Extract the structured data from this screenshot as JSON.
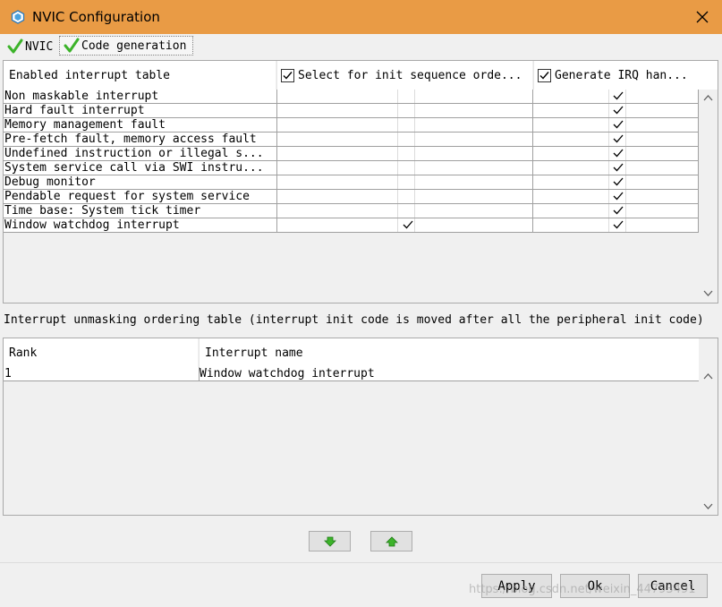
{
  "window": {
    "title": "NVIC Configuration",
    "accent": "#e99b45"
  },
  "tabs": [
    {
      "label": "NVIC",
      "icon": "check-icon"
    },
    {
      "label": "Code generation",
      "icon": "check-icon",
      "selected": true
    }
  ],
  "interrupt_table": {
    "headers": {
      "name": "Enabled interrupt table",
      "select": "Select for init sequence orde...",
      "generate": "Generate IRQ han..."
    },
    "header_checks": {
      "select": true,
      "generate": true
    },
    "rows": [
      {
        "name": "Non maskable interrupt",
        "select": false,
        "generate": true
      },
      {
        "name": "Hard fault interrupt",
        "select": false,
        "generate": true
      },
      {
        "name": "Memory management fault",
        "select": false,
        "generate": true
      },
      {
        "name": "Pre-fetch fault, memory access fault",
        "select": false,
        "generate": true
      },
      {
        "name": "Undefined instruction or illegal s...",
        "select": false,
        "generate": true
      },
      {
        "name": "System service call via SWI instru...",
        "select": false,
        "generate": true
      },
      {
        "name": "Debug monitor",
        "select": false,
        "generate": true
      },
      {
        "name": "Pendable request for system service",
        "select": false,
        "generate": true
      },
      {
        "name": "Time base: System tick timer",
        "select": false,
        "generate": true
      },
      {
        "name": "Window watchdog interrupt",
        "select": true,
        "generate": true
      }
    ]
  },
  "unmask_label": "Interrupt unmasking ordering table (interrupt init code is moved after all the peripheral init code)",
  "order_table": {
    "headers": {
      "rank": "Rank",
      "name": "Interrupt name"
    },
    "rows": [
      {
        "rank": "1",
        "name": "Window watchdog interrupt"
      }
    ]
  },
  "move_buttons": {
    "down_icon": "arrow-down-icon",
    "up_icon": "arrow-up-icon",
    "color": "#3cb32a"
  },
  "buttons": {
    "apply": "Apply",
    "ok": "Ok",
    "cancel": "Cancel"
  },
  "watermark": "https://blog.csdn.net/weixin_44793491"
}
